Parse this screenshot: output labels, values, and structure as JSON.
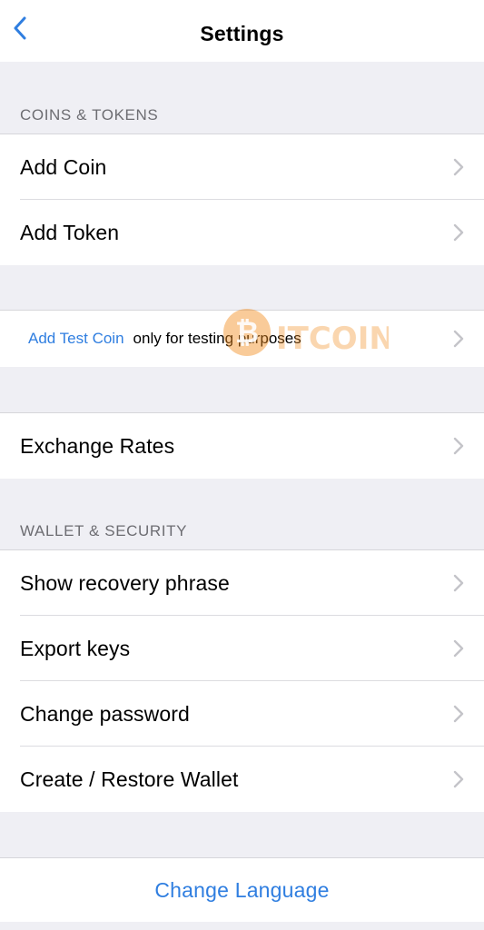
{
  "navbar": {
    "title": "Settings",
    "back_icon": "chevron-left-icon"
  },
  "sections": {
    "coins_header": "COINS & TOKENS",
    "wallet_header": "WALLET & SECURITY"
  },
  "rows": {
    "add_coin": "Add Coin",
    "add_token": "Add Token",
    "test_coin_link": "Add Test Coin",
    "test_coin_rest": "only for testing purposes",
    "exchange_rates": "Exchange Rates",
    "show_recovery": "Show recovery phrase",
    "export_keys": "Export keys",
    "change_password": "Change password",
    "create_restore": "Create / Restore Wallet",
    "change_language": "Change Language"
  },
  "watermark": {
    "text": "TÔI YÊU BITCOIN"
  },
  "colors": {
    "accent": "#2f7ee0",
    "background": "#efeff4",
    "section_text": "#6d6d72",
    "chevron": "#c4c4c9",
    "watermark": "#f28c1d"
  }
}
